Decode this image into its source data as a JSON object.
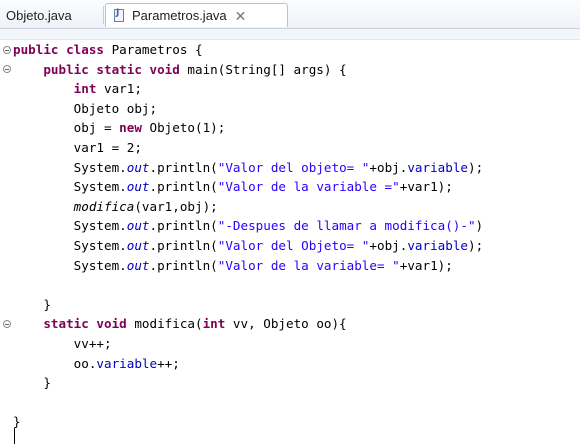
{
  "tabs": [
    {
      "label": "Objeto.java"
    },
    {
      "label": "Parametros.java"
    }
  ],
  "code": [
    {
      "indent": "",
      "tokens": [
        {
          "t": "kw",
          "v": "public class"
        },
        {
          "t": "plain",
          "v": " Parametros {"
        }
      ]
    },
    {
      "indent": "    ",
      "tokens": [
        {
          "t": "kw",
          "v": "public static void"
        },
        {
          "t": "plain",
          "v": " main(String[] args) {"
        }
      ]
    },
    {
      "indent": "        ",
      "tokens": [
        {
          "t": "kw",
          "v": "int"
        },
        {
          "t": "plain",
          "v": " var1;"
        }
      ]
    },
    {
      "indent": "        ",
      "tokens": [
        {
          "t": "plain",
          "v": "Objeto obj;"
        }
      ]
    },
    {
      "indent": "        ",
      "tokens": [
        {
          "t": "plain",
          "v": "obj = "
        },
        {
          "t": "kw",
          "v": "new"
        },
        {
          "t": "plain",
          "v": " Objeto(1);"
        }
      ]
    },
    {
      "indent": "        ",
      "tokens": [
        {
          "t": "plain",
          "v": "var1 = 2;"
        }
      ]
    },
    {
      "indent": "        ",
      "tokens": [
        {
          "t": "plain",
          "v": "System."
        },
        {
          "t": "sfld",
          "v": "out"
        },
        {
          "t": "plain",
          "v": ".println("
        },
        {
          "t": "str",
          "v": "\"Valor del objeto= \""
        },
        {
          "t": "plain",
          "v": "+obj."
        },
        {
          "t": "fld",
          "v": "variable"
        },
        {
          "t": "plain",
          "v": ");"
        }
      ]
    },
    {
      "indent": "        ",
      "tokens": [
        {
          "t": "plain",
          "v": "System."
        },
        {
          "t": "sfld",
          "v": "out"
        },
        {
          "t": "plain",
          "v": ".println("
        },
        {
          "t": "str",
          "v": "\"Valor de la variable =\""
        },
        {
          "t": "plain",
          "v": "+var1);"
        }
      ]
    },
    {
      "indent": "        ",
      "tokens": [
        {
          "t": "ital",
          "v": "modifica"
        },
        {
          "t": "plain",
          "v": "(var1,obj);"
        }
      ]
    },
    {
      "indent": "        ",
      "tokens": [
        {
          "t": "plain",
          "v": "System."
        },
        {
          "t": "sfld",
          "v": "out"
        },
        {
          "t": "plain",
          "v": ".println("
        },
        {
          "t": "str",
          "v": "\"-Despues de llamar a modifica()-\""
        },
        {
          "t": "plain",
          "v": ")"
        }
      ]
    },
    {
      "indent": "        ",
      "tokens": [
        {
          "t": "plain",
          "v": "System."
        },
        {
          "t": "sfld",
          "v": "out"
        },
        {
          "t": "plain",
          "v": ".println("
        },
        {
          "t": "str",
          "v": "\"Valor del Objeto= \""
        },
        {
          "t": "plain",
          "v": "+obj."
        },
        {
          "t": "fld",
          "v": "variable"
        },
        {
          "t": "plain",
          "v": ");"
        }
      ]
    },
    {
      "indent": "        ",
      "tokens": [
        {
          "t": "plain",
          "v": "System."
        },
        {
          "t": "sfld",
          "v": "out"
        },
        {
          "t": "plain",
          "v": ".println("
        },
        {
          "t": "str",
          "v": "\"Valor de la variable= \""
        },
        {
          "t": "plain",
          "v": "+var1);"
        }
      ]
    },
    {
      "indent": "",
      "tokens": []
    },
    {
      "indent": "    ",
      "tokens": [
        {
          "t": "plain",
          "v": "}"
        }
      ]
    },
    {
      "indent": "    ",
      "tokens": [
        {
          "t": "kw",
          "v": "static void"
        },
        {
          "t": "plain",
          "v": " modifica("
        },
        {
          "t": "kw",
          "v": "int"
        },
        {
          "t": "plain",
          "v": " vv, Objeto oo){"
        }
      ]
    },
    {
      "indent": "        ",
      "tokens": [
        {
          "t": "plain",
          "v": "vv++;"
        }
      ]
    },
    {
      "indent": "        ",
      "tokens": [
        {
          "t": "plain",
          "v": "oo."
        },
        {
          "t": "fld",
          "v": "variable"
        },
        {
          "t": "plain",
          "v": "++;"
        }
      ]
    },
    {
      "indent": "    ",
      "tokens": [
        {
          "t": "plain",
          "v": "}"
        }
      ]
    },
    {
      "indent": "",
      "tokens": []
    },
    {
      "indent": "",
      "tokens": [
        {
          "t": "plain",
          "v": "}"
        }
      ]
    }
  ],
  "colors": {
    "keyword": "#7f0055",
    "string": "#2a00ff",
    "field": "#0000c0"
  }
}
